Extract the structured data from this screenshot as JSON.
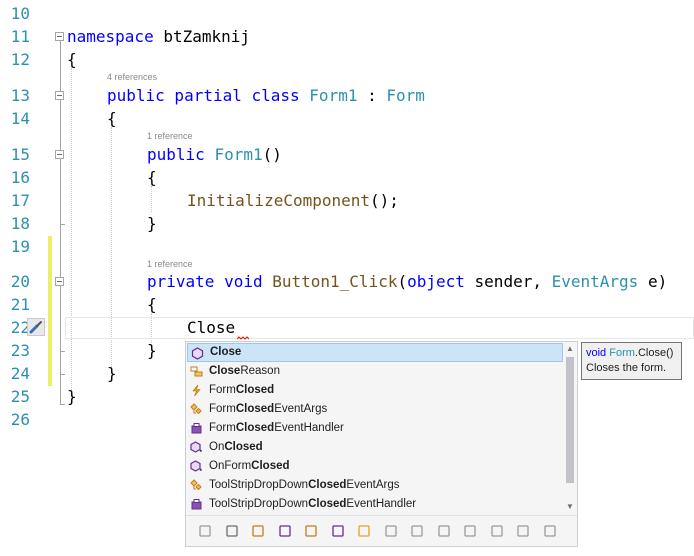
{
  "line_numbers": [
    "10",
    "11",
    "12",
    "13",
    "14",
    "15",
    "16",
    "17",
    "18",
    "19",
    "20",
    "21",
    "22",
    "23",
    "24",
    "25",
    "26"
  ],
  "code": {
    "namespace_kw": "namespace",
    "namespace_name": " btZamknij",
    "brace_open": "{",
    "brace_close": "}",
    "class_lens": "4 references",
    "class_mods": "public partial class",
    "class_name": "Form1",
    "class_colon": " : ",
    "class_base": "Form",
    "ctor_lens": "1 reference",
    "ctor_mod": "public",
    "ctor_name": "Form1",
    "ctor_parens": "()",
    "init_call": "InitializeComponent",
    "init_end": "();",
    "handler_lens": "1 reference",
    "handler_mods": "private void",
    "handler_name": "Button1_Click",
    "handler_p1": "(",
    "handler_obj": "object",
    "handler_sender": " sender, ",
    "handler_eventargs": "EventArgs",
    "handler_e": " e)",
    "typed_text": "Close"
  },
  "completion": {
    "items": [
      {
        "icon": "method-icon",
        "prefix": "",
        "match": "Close",
        "suffix": "",
        "selected": true
      },
      {
        "icon": "enum-icon",
        "prefix": "",
        "match": "Close",
        "suffix": "Reason",
        "selected": false
      },
      {
        "icon": "event-icon",
        "prefix": "Form",
        "match": "Closed",
        "suffix": "",
        "selected": false
      },
      {
        "icon": "class-icon",
        "prefix": "Form",
        "match": "Closed",
        "suffix": "EventArgs",
        "selected": false
      },
      {
        "icon": "delegate-icon",
        "prefix": "Form",
        "match": "Closed",
        "suffix": "EventHandler",
        "selected": false
      },
      {
        "icon": "protected-method-icon",
        "prefix": "On",
        "match": "Closed",
        "suffix": "",
        "selected": false
      },
      {
        "icon": "protected-method-icon",
        "prefix": "OnForm",
        "match": "Closed",
        "suffix": "",
        "selected": false
      },
      {
        "icon": "class-icon",
        "prefix": "ToolStripDropDown",
        "match": "Closed",
        "suffix": "EventArgs",
        "selected": false
      },
      {
        "icon": "delegate-icon",
        "prefix": "ToolStripDropDown",
        "match": "Closed",
        "suffix": "EventHandler",
        "selected": false
      }
    ],
    "filters": [
      "snippet-filter-icon",
      "wrench-filter-icon",
      "enum-filter-icon",
      "method-filter-icon",
      "class-filter-icon",
      "delegate-filter-icon",
      "event-filter-icon",
      "field-filter-icon",
      "property-filter-icon",
      "namespace-filter-icon",
      "struct-filter-icon",
      "interface-filter-icon",
      "key-filter-icon",
      "module-filter-icon"
    ]
  },
  "tooltip": {
    "kw": "void",
    "type": "Form",
    "member": ".Close()",
    "description": "Closes the form."
  },
  "colors": {
    "keyword": "#0000ff",
    "type": "#2b91af",
    "method": "#74531f",
    "line_number": "#2b91af",
    "change_bar": "#eeee66",
    "selection": "#cce4f7"
  }
}
